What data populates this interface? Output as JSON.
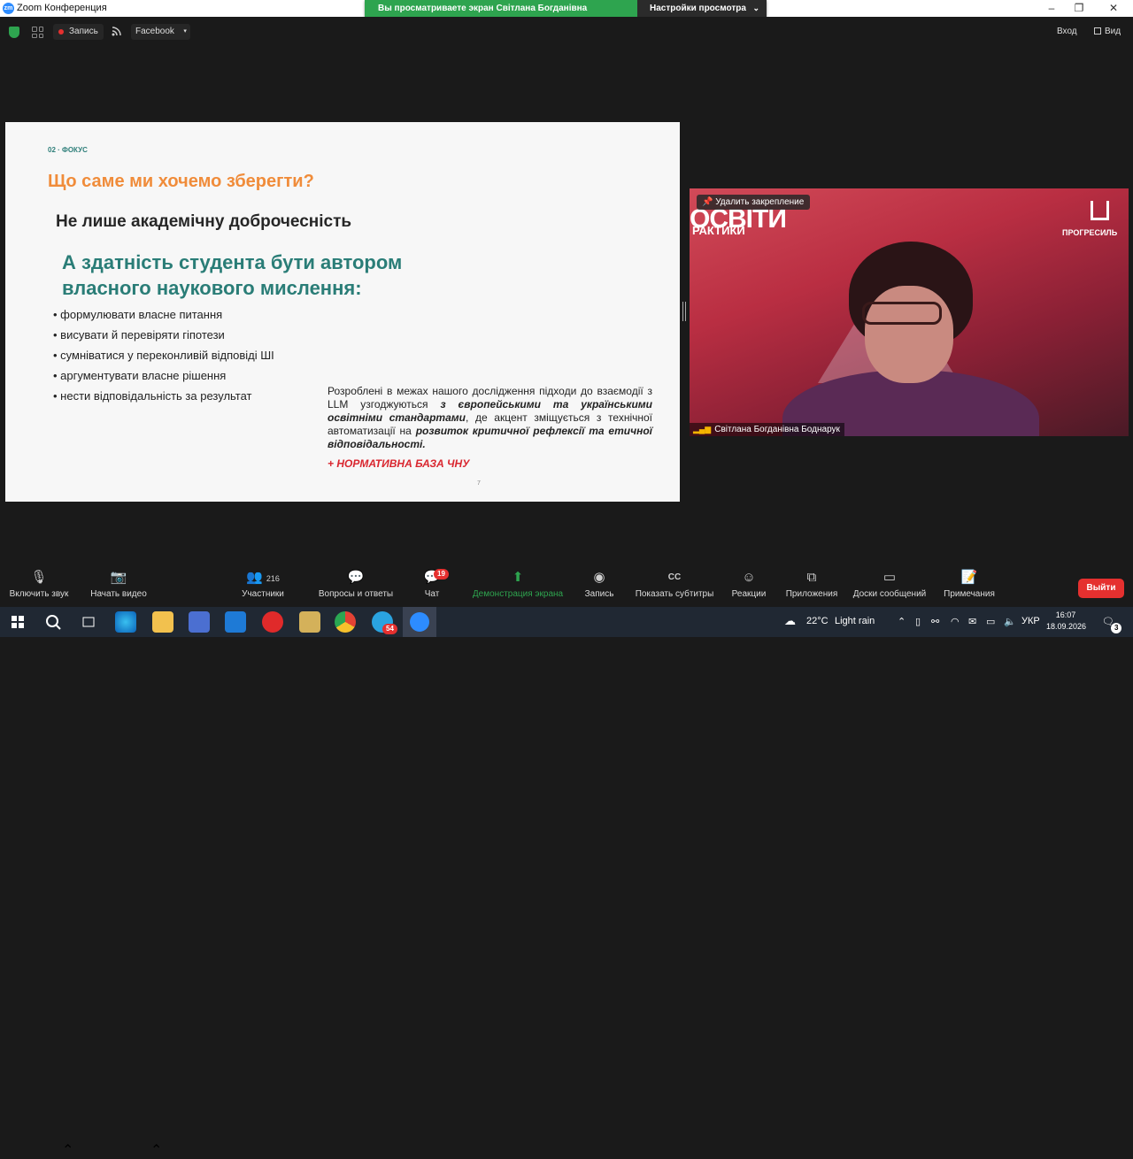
{
  "window": {
    "app_title": "Zoom Конференция",
    "app_icon_text": "zm",
    "controls": {
      "minimize": "–",
      "maximize": "❐",
      "close": "✕"
    }
  },
  "share_banner": {
    "viewing": "Вы просматриваете экран Світлана Богданівна Боднарук",
    "settings": "Настройки просмотра",
    "caret": "⌄"
  },
  "topbar": {
    "record": "Запись",
    "facebook": "Facebook",
    "caret": "▾",
    "exit": "Вход",
    "view": "Вид"
  },
  "slide": {
    "kicker": "02 · ФОКУС",
    "question": "Що саме ми хочемо зберегти?",
    "heading": "Не лише академічну доброчесність",
    "subheading": "А здатність студента бути автором власного наукового мислення:",
    "bullets": [
      "формулювати власне питання",
      "висувати й перевіряти гіпотези",
      "сумніватися у переконливій відповіді ШІ",
      "аргументувати власне рішення",
      "нести відповідальність за результат"
    ],
    "para_1": "Розроблені в межах нашого дослідження підходи до взаємодії з LLM узгоджуються",
    "para_2": "з європейськими та українськими освітніми стандартами",
    "para_3": ", де акцент зміщується з технічної автоматизації на",
    "para_4": "розвиток критичної рефлексії та етичної відповідальності.",
    "normative": "+ НОРМАТИВНА БАЗА ЧНУ",
    "page_number": "7"
  },
  "video": {
    "unpin": "Удалить закрепление",
    "participant_name": "Світлана Богданівна Боднарук",
    "logo_left_1": "ОСВІТИ",
    "logo_left_2": "РАКТИКИ",
    "logo_right": "ПРОГРЕСИЛЬ"
  },
  "toolbar": {
    "mute": "Включить звук",
    "video": "Начать видео",
    "participants": "Участники",
    "participants_count": "216",
    "qa": "Вопросы и ответы",
    "chat": "Чат",
    "chat_badge": "19",
    "share": "Демонстрация экрана",
    "record": "Запись",
    "captions": "Показать субтитры",
    "captions_icon": "CC",
    "reactions": "Реакции",
    "apps": "Приложения",
    "whiteboards": "Доски сообщений",
    "notes": "Примечания",
    "leave": "Выйти"
  },
  "taskbar": {
    "weather": "22°C",
    "weather_text": "Light rain",
    "language": "УКР",
    "time": "16:07",
    "date": "18.09.2026",
    "notification_count": "3",
    "telegram_badge": "54"
  },
  "colors": {
    "zoom_blue": "#2d8cff",
    "share_green": "#2ea44f",
    "leave_red": "#e5302f",
    "slide_orange": "#f08c3a",
    "slide_teal": "#2a7d77"
  }
}
